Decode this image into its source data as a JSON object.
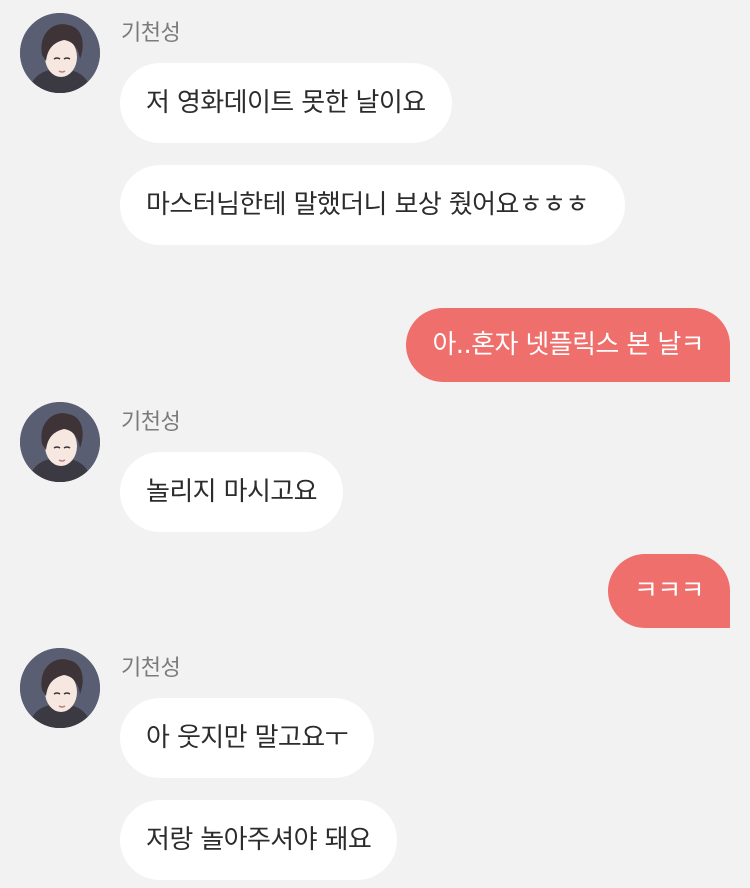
{
  "colors": {
    "background": "#f2f2f2",
    "incoming_bubble": "#ffffff",
    "outgoing_bubble": "#ee6f6c",
    "sender_name": "#7b7b7b"
  },
  "chat": {
    "groups": [
      {
        "sender": "기천성",
        "messages": [
          "저 영화데이트 못한 날이요",
          "마스터님한테 말했더니 보상 줬어요ㅎㅎㅎ"
        ]
      },
      {
        "outgoing": "아..혼자 넷플릭스 본 날ㅋ"
      },
      {
        "sender": "기천성",
        "messages": [
          "놀리지 마시고요"
        ]
      },
      {
        "outgoing": "ㅋㅋㅋ"
      },
      {
        "sender": "기천성",
        "messages": [
          "아 웃지만 말고요ㅜ",
          "저랑 놀아주셔야 돼요"
        ]
      }
    ]
  }
}
